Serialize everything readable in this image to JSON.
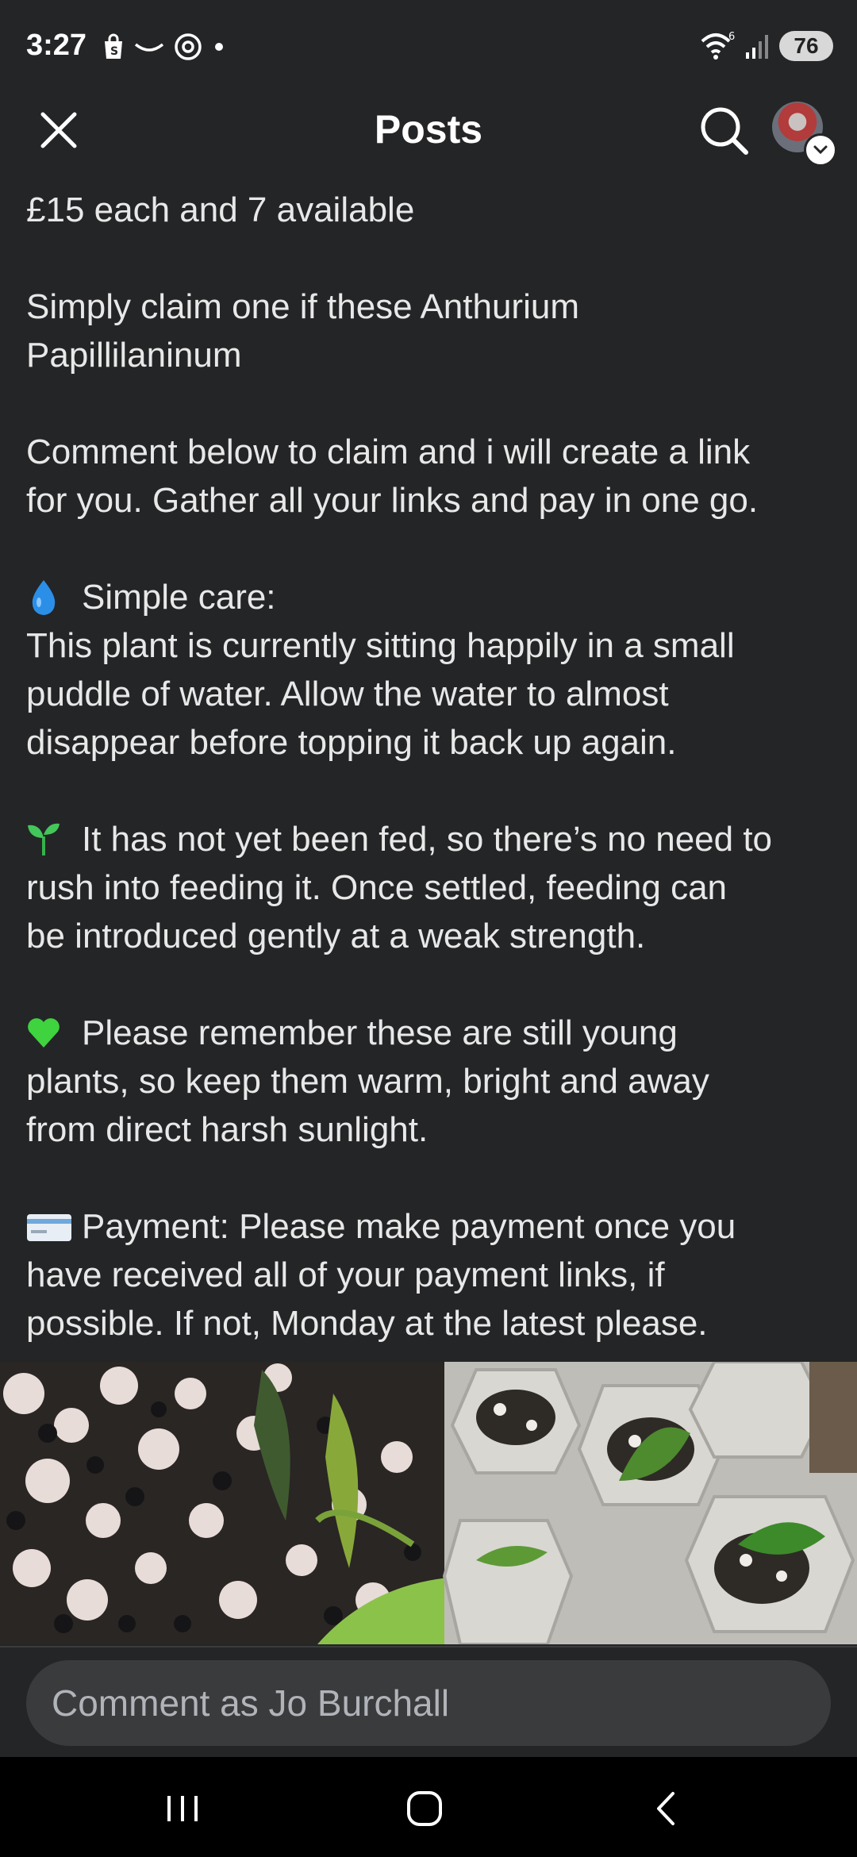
{
  "status_bar": {
    "time": "3:27",
    "battery": "76",
    "wifi_label": "6"
  },
  "header": {
    "title": "Posts"
  },
  "post": {
    "paragraphs": [
      {
        "lines": [
          "£15 each and 7 available"
        ]
      },
      {
        "lines": [
          "Simply claim one if these Anthurium",
          "Papillilaninum"
        ]
      },
      {
        "lines": [
          "Comment below to claim and i will create a link",
          "for you. Gather all your links and pay in one go."
        ]
      },
      {
        "emoji": "droplet-icon",
        "lines": [
          "Simple care:",
          "This plant is currently sitting happily in a small",
          "puddle of water. Allow the water to almost",
          "disappear before topping it back up again."
        ]
      },
      {
        "emoji": "seedling-icon",
        "lines": [
          "It has not yet been fed, so there’s no need to",
          "rush into feeding it. Once settled, feeding can",
          "be introduced gently at a weak strength."
        ]
      },
      {
        "emoji": "green-heart-icon",
        "lines": [
          "Please remember these are still young",
          "plants, so keep them warm, bright and away",
          "from direct harsh sunlight."
        ]
      },
      {
        "emoji": "credit-card-icon",
        "lines": [
          "Payment: Please make payment once you",
          "have received all of your payment links, if",
          "possible. If not, Monday at the latest please."
        ]
      }
    ]
  },
  "comment": {
    "placeholder": "Comment as Jo Burchall"
  },
  "colors": {
    "background": "#242527",
    "text": "#e8e8e8",
    "input_bg": "#3a3b3c",
    "nav_bg": "#000000"
  }
}
